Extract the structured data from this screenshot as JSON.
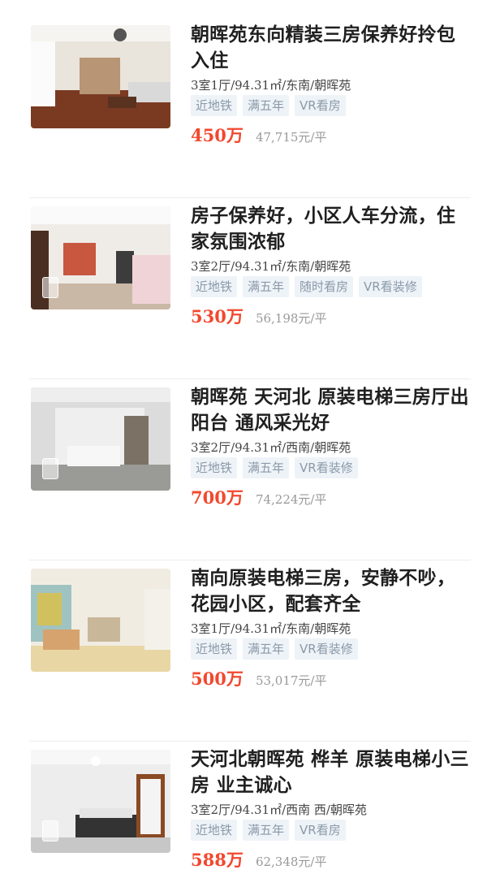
{
  "listings": [
    {
      "title": "朝晖苑东向精装三房保养好拎包入住",
      "meta": "3室1厅/94.31㎡/东南/朝晖苑",
      "tags": [
        "近地铁",
        "满五年",
        "VR看房"
      ],
      "price": "450万",
      "unit_price": "47,715元/平"
    },
    {
      "title": "房子保养好，小区人车分流，住家氛围浓郁",
      "meta": "3室2厅/94.31㎡/东南/朝晖苑",
      "tags": [
        "近地铁",
        "满五年",
        "随时看房",
        "VR看装修"
      ],
      "price": "530万",
      "unit_price": "56,198元/平"
    },
    {
      "title": "朝晖苑 天河北 原装电梯三房厅出阳台 通风采光好",
      "meta": "3室2厅/94.31㎡/西南/朝晖苑",
      "tags": [
        "近地铁",
        "满五年",
        "VR看装修"
      ],
      "price": "700万",
      "unit_price": "74,224元/平"
    },
    {
      "title": "南向原装电梯三房，安静不吵，花园小区，配套齐全",
      "meta": "3室1厅/94.31㎡/东南/朝晖苑",
      "tags": [
        "近地铁",
        "满五年",
        "VR看装修"
      ],
      "price": "500万",
      "unit_price": "53,017元/平"
    },
    {
      "title": "天河北朝晖苑 桦羊 原装电梯小三房 业主诚心",
      "meta": "3室2厅/94.31㎡/西南 西/朝晖苑",
      "tags": [
        "近地铁",
        "满五年",
        "VR看房"
      ],
      "price": "588万",
      "unit_price": "62,348元/平"
    }
  ],
  "colors": {
    "price": "#f2482e",
    "tag_bg": "#eef3f8",
    "tag_text": "#8a99a8"
  }
}
